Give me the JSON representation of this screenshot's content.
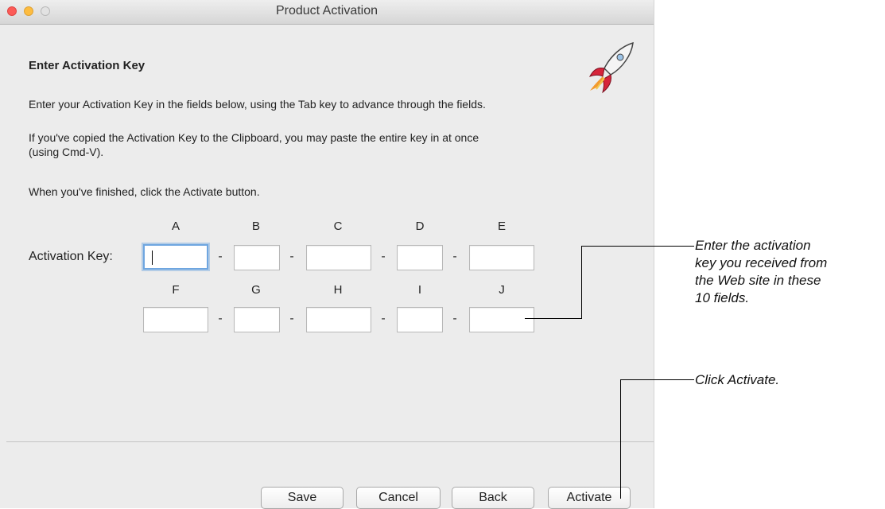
{
  "window": {
    "title": "Product Activation"
  },
  "content": {
    "heading": "Enter Activation Key",
    "para1": "Enter your Activation Key in the fields below, using the Tab key to advance through the fields.",
    "para2_line1": "If you've copied the Activation Key to the Clipboard, you may paste the entire key in at once",
    "para2_line2": "(using Cmd-V).",
    "para3": "When you've finished, click the Activate button.",
    "key_label": "Activation Key:",
    "row1_letters": [
      "A",
      "B",
      "C",
      "D",
      "E"
    ],
    "row2_letters": [
      "F",
      "G",
      "H",
      "I",
      "J"
    ],
    "separator": "-"
  },
  "buttons": {
    "save": "Save",
    "cancel": "Cancel",
    "back": "Back",
    "activate": "Activate"
  },
  "callouts": {
    "fields_l1": "Enter the activation",
    "fields_l2": "key you received from",
    "fields_l3": "the Web site in these",
    "fields_l4": "10 fields.",
    "activate": "Click Activate."
  }
}
